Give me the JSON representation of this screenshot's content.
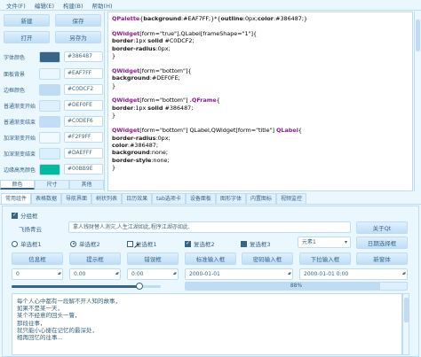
{
  "menu": [
    "文件(F)",
    "编辑(E)",
    "构建(B)",
    "帮助(H)"
  ],
  "left": {
    "buttons": {
      "new": "新建",
      "save": "保存",
      "open": "打开",
      "save_as": "另存为"
    },
    "colors": [
      {
        "label": "字体颜色",
        "hex": "#386487",
        "swatch": "#386487"
      },
      {
        "label": "面板背景",
        "hex": "#EAF7FF",
        "swatch": "#EAF7FF"
      },
      {
        "label": "边框颜色",
        "hex": "#C0DCF2",
        "swatch": "#C0DCF2"
      },
      {
        "label": "普通渐变开始",
        "hex": "#DEF0FE",
        "swatch": "#DEF0FE"
      },
      {
        "label": "普通渐变结束",
        "hex": "#C0DEF6",
        "swatch": "#C0DEF6"
      },
      {
        "label": "加深渐变开始",
        "hex": "#F2F9FF",
        "swatch": "#F2F9FF"
      },
      {
        "label": "加深渐变结束",
        "hex": "#DAEFFF",
        "swatch": "#DAEFFF"
      },
      {
        "label": "边缘高亮颜色",
        "hex": "#00BB9E",
        "swatch": "#00BB9E"
      }
    ],
    "tabs": [
      "颜色",
      "尺寸",
      "其他"
    ]
  },
  "code_lines": [
    [
      [
        "sel",
        "QPalette"
      ],
      [
        "val",
        "{"
      ],
      [
        "prop",
        "background"
      ],
      [
        "val",
        ":#EAF7FF;}*{"
      ],
      [
        "prop",
        "outline"
      ],
      [
        "val",
        ":0px;"
      ],
      [
        "prop",
        "color"
      ],
      [
        "val",
        ":#386487;}"
      ]
    ],
    [
      [
        "val",
        ""
      ]
    ],
    [
      [
        "sel",
        "QWidget"
      ],
      [
        "val",
        "[form=\"true\"],QLabel[frameShape=\"1\"]{"
      ]
    ],
    [
      [
        "prop",
        "border"
      ],
      [
        "val",
        ":1px "
      ],
      [
        "prop",
        "solid"
      ],
      [
        "val",
        " #C0DCF2;"
      ]
    ],
    [
      [
        "prop",
        "border-radius"
      ],
      [
        "val",
        ":0px;"
      ]
    ],
    [
      [
        "val",
        "}"
      ]
    ],
    [
      [
        "val",
        ""
      ]
    ],
    [
      [
        "sel",
        "QWidget"
      ],
      [
        "val",
        "[form=\"bottom\"]{"
      ]
    ],
    [
      [
        "prop",
        "background"
      ],
      [
        "val",
        ":#DEF0FE;"
      ]
    ],
    [
      [
        "val",
        "}"
      ]
    ],
    [
      [
        "val",
        ""
      ]
    ],
    [
      [
        "sel",
        "QWidget"
      ],
      [
        "val",
        "[form=\"bottom\"] "
      ],
      [
        "sel",
        ".QFrame"
      ],
      [
        "val",
        "{"
      ]
    ],
    [
      [
        "prop",
        "border"
      ],
      [
        "val",
        ":1px "
      ],
      [
        "prop",
        "solid"
      ],
      [
        "val",
        " #386487;"
      ]
    ],
    [
      [
        "val",
        "}"
      ]
    ],
    [
      [
        "val",
        ""
      ]
    ],
    [
      [
        "sel",
        "QWidget"
      ],
      [
        "val",
        "[form=\"bottom\"] QLabel,QWidget[form=\"title\"] "
      ],
      [
        "sel",
        "QLabel"
      ],
      [
        "val",
        "{"
      ]
    ],
    [
      [
        "prop",
        "border-radius"
      ],
      [
        "val",
        ":0px;"
      ]
    ],
    [
      [
        "prop",
        "color"
      ],
      [
        "val",
        ":#386487;"
      ]
    ],
    [
      [
        "prop",
        "background"
      ],
      [
        "val",
        ":none;"
      ]
    ],
    [
      [
        "prop",
        "border-style"
      ],
      [
        "val",
        ":none;"
      ]
    ],
    [
      [
        "val",
        "}"
      ]
    ]
  ],
  "main_tabs": [
    "常用组件",
    "表格数据",
    "导航界面",
    "树状列表",
    "日历效果",
    "tab选项卡",
    "设备面板",
    "图形字体",
    "内置图标",
    "视频监控"
  ],
  "group": {
    "title": "分组框",
    "label_line": "飞扬青云",
    "motto": "拿人钱财替人消灾,人生江湖如此,程序江湖亦如此.",
    "about_btn": "关于Qt",
    "radios": [
      "单选框1",
      "单选框2"
    ],
    "checks": [
      "复选框1",
      "复选框2",
      "复选框3"
    ],
    "combo": "元素1",
    "date_btn": "日期选择框",
    "buttons": [
      "信息框",
      "提示框",
      "错误框",
      "标准输入框",
      "密码输入框",
      "下拉输入框",
      "新窗体"
    ],
    "spin1": "0",
    "spin2": "0.00",
    "time": "0:00",
    "date1": "2000-01-01",
    "date2": "2000-01-01 0:00",
    "progress_pct": 88,
    "progress_text": "88%",
    "slider_value": 0.86,
    "text": "每个人心中都有一段解不开人知的故事，\n如果不是某一天，\n某个不经意的回头一瞥，\n那段往事，\n就只能小心捷在记忆的最深处，\n相再回忆的往事..."
  }
}
